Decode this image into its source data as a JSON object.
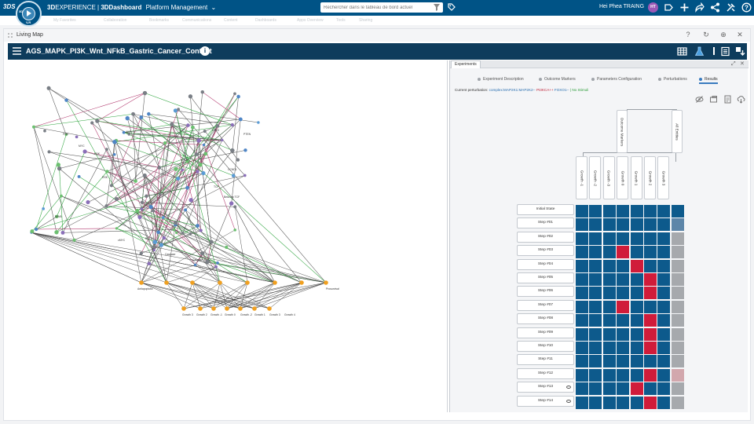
{
  "topbar": {
    "logo": "3DS",
    "compass_top": "3D",
    "compass_bottom": "V,R",
    "brand_bold": "3D",
    "brand_rest": "EXPERIENCE | ",
    "brand_dash": "3DDashboard",
    "dashboard_name": "Platform Management",
    "search_placeholder": "Rechercher dans le tableau de bord actuel",
    "user_name": "Hei Phea TRAING",
    "avatar_initials": "HT"
  },
  "ghost_tabs": [
    "My Favorites",
    "Collaboration",
    "Bookmarks",
    "Communications",
    "Content",
    "Dashboards",
    "Apps Overview",
    "Tools",
    "Sharing"
  ],
  "widget": {
    "title": "Living Map",
    "model_title": "AGS_MAPK_PI3K_Wnt_NFkB_Gastric_Cancer_Context",
    "info_icon": "i"
  },
  "network": {
    "labels": [
      "Growth 3",
      "Growth 2",
      "Growth -1",
      "Growth 0",
      "Growth -2",
      "Growth 1",
      "Growth 3",
      "Growth 4",
      "Antiapoptotic",
      "Prosurvival",
      "Caspase",
      "ERK",
      "AKT",
      "mTOR",
      "NFkB",
      "GSK3",
      "TCF",
      "CCND1",
      "RSK",
      "MYC",
      "cMYC",
      "Beta-cat TCF",
      "Caspase-3",
      "BCL-2",
      "PI3K",
      "PTEN"
    ]
  },
  "experiments": {
    "panel_tab": "Experiments",
    "tabs": [
      {
        "label": "Experiment Description",
        "active": false
      },
      {
        "label": "Outcome Markers",
        "active": false
      },
      {
        "label": "Parameters Configuration",
        "active": false
      },
      {
        "label": "Perturbations",
        "active": false
      },
      {
        "label": "Results",
        "active": true
      }
    ],
    "current_label": "Current perturbation: ",
    "pert_blue": "complex:MAP2K1:MAP2K2-- ",
    "pert_red": "PI3KCA++ ",
    "pert_blue2": "FOXO1-- ",
    "pert_green": "| No Stimuli",
    "group_headers": [
      "Outcome Markers",
      "All Entities"
    ],
    "columns": [
      "Growth -1",
      "Growth -2",
      "Growth -3",
      "Growth 0",
      "Growth 1",
      "Growth 2",
      "Growth 3"
    ],
    "rows": [
      "Initial State",
      "Step #01",
      "Step #02",
      "Step #03",
      "Step #04",
      "Step #05",
      "Step #06",
      "Step #07",
      "Step #08",
      "Step #09",
      "Step #10",
      "Step #11",
      "Step #12",
      "Step #13",
      "Step #14"
    ],
    "rows_with_eye": [
      13,
      14
    ],
    "matrix": [
      "BBBBBBBB",
      "BBBBBBBS",
      "BBBBBBBG",
      "BBBRBBBG",
      "BBBBRBBG",
      "BBBBBRBG",
      "BBBBBRBG",
      "BBBRBBBG",
      "BBBBBRBG",
      "BBBBBRBG",
      "BBBBBRBG",
      "BBBBBBBG",
      "BBBBBRBP",
      "BBBBRBBG",
      "BBBBBRBG"
    ],
    "colors": {
      "B": "#0d5a8c",
      "R": "#d01c3a",
      "G": "#a6a9ad",
      "S": "#5d86a9",
      "P": "#d2a7ad"
    }
  }
}
